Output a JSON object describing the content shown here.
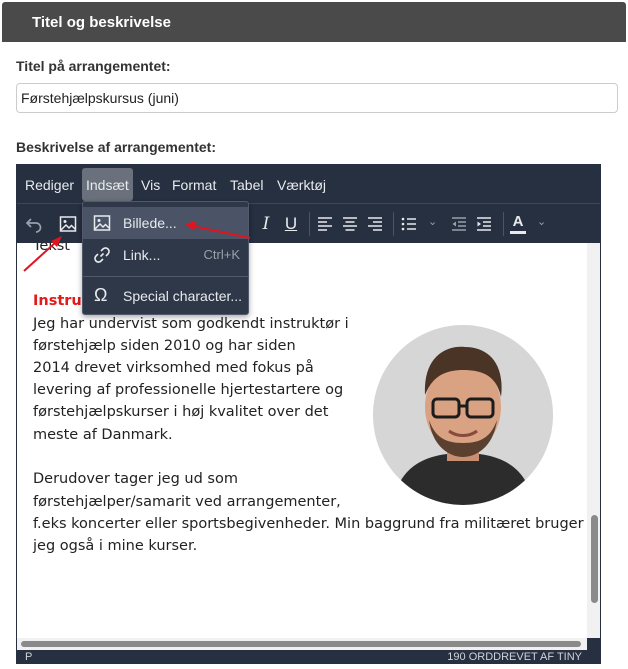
{
  "panel": {
    "title": "Titel og beskrivelse"
  },
  "form": {
    "title_label": "Titel på arrangementet:",
    "title_value": "Førstehjælpskursus (juni)",
    "description_label": "Beskrivelse af arrangementet:"
  },
  "editor": {
    "menubar": [
      "Rediger",
      "Indsæt",
      "Vis",
      "Format",
      "Tabel",
      "Værktøj"
    ],
    "active_menu": "Indsæt",
    "dropdown": {
      "items": [
        {
          "label": "Billede...",
          "icon": "image-icon",
          "shortcut": ""
        },
        {
          "label": "Link...",
          "icon": "link-icon",
          "shortcut": "Ctrl+K"
        },
        {
          "label": "Special character...",
          "icon": "omega-icon",
          "shortcut": ""
        }
      ]
    },
    "toolbar_icons": [
      "undo-icon",
      "image-icon",
      "italic-icon",
      "underline-icon",
      "align-left-icon",
      "align-center-icon",
      "align-right-icon",
      "bullet-list-icon",
      "outdent-icon",
      "indent-icon",
      "text-color-icon"
    ],
    "content": {
      "top_cut": "Tekst",
      "heading": "Instruk",
      "paragraph1": [
        "Jeg har undervist som godkendt instruktør i",
        "førstehjælp siden 2010 og har siden",
        "2014 drevet virksomhed med fokus på",
        "levering af professionelle hjertestartere og",
        "førstehjælpskurser i høj kvalitet over det",
        "meste af Danmark."
      ],
      "paragraph2": [
        "Derudover tager jeg ud som",
        "førstehjælper/samarit ved arrangementer,",
        "f.eks koncerter eller sportsbegivenheder. Min baggrund fra militæret bruger",
        "jeg også i mine kurser."
      ]
    },
    "status": {
      "path": "P",
      "words": "190 ORD",
      "brand": "DREVET AF TINY"
    }
  },
  "colors": {
    "editor_bg": "#263040",
    "heading": "#e21b1b",
    "arrow": "#e0141e",
    "panel_header": "#4a4a4a"
  }
}
